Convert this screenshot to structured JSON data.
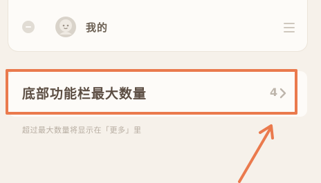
{
  "tab_bar_list": {
    "items": [
      {
        "label": "我的",
        "icon": "avatar-icon",
        "action_icon": "remove-icon",
        "handle_icon": "drag-handle-icon"
      }
    ]
  },
  "max_tabs_setting": {
    "label": "底部功能栏最大数量",
    "value": "4",
    "chevron_icon": "chevron-right-icon",
    "hint": "超过最大数量将显示在「更多」里"
  },
  "annotation": {
    "highlight_color": "#ea7a4d",
    "arrow_icon": "pointer-arrow-icon"
  }
}
